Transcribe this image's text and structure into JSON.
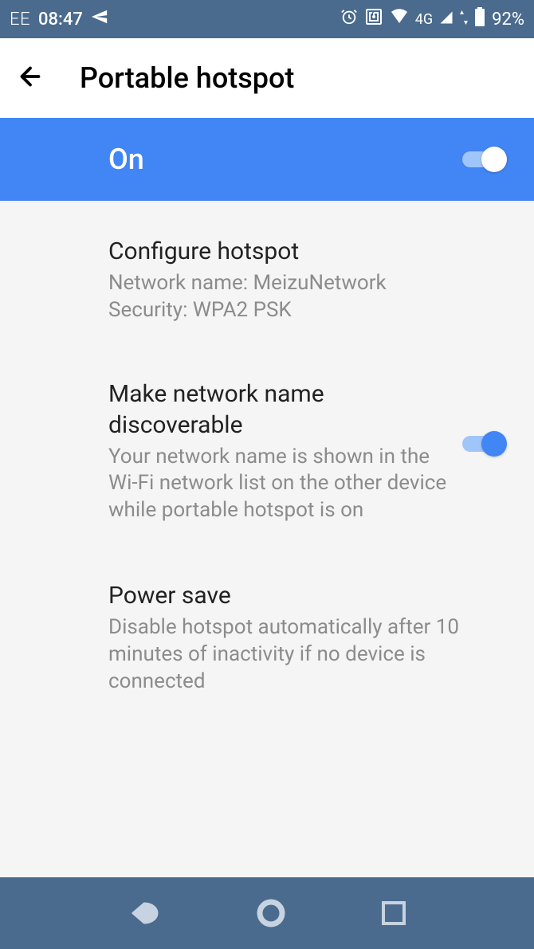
{
  "status": {
    "carrier": "EE",
    "time": "08:47",
    "battery": "92%",
    "network": "4G"
  },
  "header": {
    "title": "Portable hotspot"
  },
  "main_toggle": {
    "label": "On",
    "state": true
  },
  "settings": [
    {
      "title": "Configure hotspot",
      "subtitle_line1": "Network name: MeizuNetwork",
      "subtitle_line2": "Security: WPA2 PSK"
    },
    {
      "title": "Make network name discoverable",
      "subtitle": "Your network name is shown in the Wi-Fi network list on the other device while portable hotspot is on",
      "toggle": true
    },
    {
      "title": "Power save",
      "subtitle": "Disable hotspot automatically after 10 minutes of inactivity if no device is connected"
    }
  ]
}
